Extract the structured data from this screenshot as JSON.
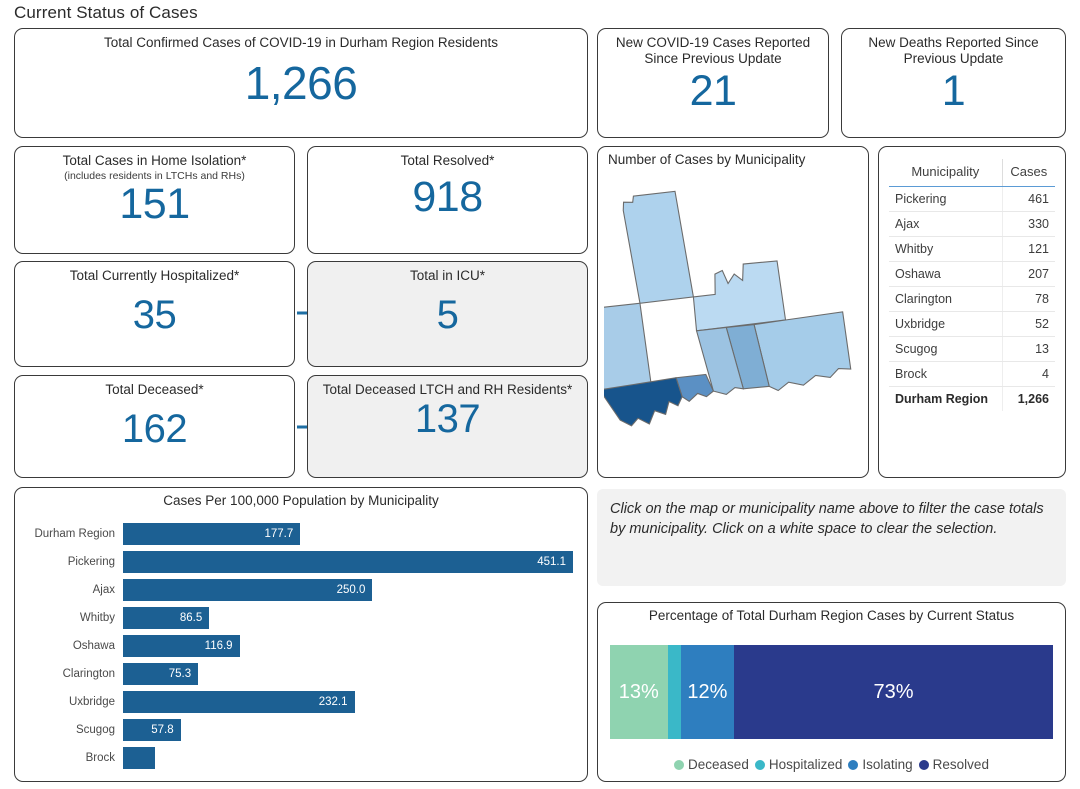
{
  "page_title": "Current Status of Cases",
  "colors": {
    "kpi_blue": "#15679E",
    "bar_blue": "#1C6093",
    "arrow_blue": "#1D6EA3",
    "deceased": "#8FD3B0",
    "hospitalized": "#3AB8C8",
    "isolating": "#2E7EBF",
    "resolved": "#2A3A8C",
    "card_border": "#3A3A3A",
    "shaded_card_bg": "#F0F0F0"
  },
  "cards": {
    "total_confirmed": {
      "title": "Total Confirmed Cases of COVID-19 in Durham Region Residents",
      "value": "1,266"
    },
    "new_cases": {
      "title": "New COVID-19 Cases Reported Since Previous Update",
      "value": "21"
    },
    "new_deaths": {
      "title": "New Deaths Reported Since Previous Update",
      "value": "1"
    },
    "home_isolation": {
      "title": "Total Cases in Home Isolation*",
      "subtitle": "(includes residents in LTCHs and RHs)",
      "value": "151"
    },
    "resolved": {
      "title": "Total Resolved*",
      "value": "918"
    },
    "hospitalized": {
      "title": "Total Currently Hospitalized*",
      "value": "35"
    },
    "icu": {
      "title": "Total in ICU*",
      "value": "5"
    },
    "deceased": {
      "title": "Total Deceased*",
      "value": "162"
    },
    "deceased_ltch": {
      "title": "Total Deceased LTCH and RH Residents*",
      "value": "137"
    }
  },
  "map_panel": {
    "title": "Number of Cases by Municipality"
  },
  "municipality_table": {
    "headers": [
      "Municipality",
      "Cases"
    ],
    "rows": [
      {
        "name": "Pickering",
        "cases": "461"
      },
      {
        "name": "Ajax",
        "cases": "330"
      },
      {
        "name": "Whitby",
        "cases": "121"
      },
      {
        "name": "Oshawa",
        "cases": "207"
      },
      {
        "name": "Clarington",
        "cases": "78"
      },
      {
        "name": "Uxbridge",
        "cases": "52"
      },
      {
        "name": "Scugog",
        "cases": "13"
      },
      {
        "name": "Brock",
        "cases": "4"
      }
    ],
    "total": {
      "name": "Durham Region",
      "cases": "1,266"
    }
  },
  "instructions": {
    "text": "Click on the map or municipality name above to filter the case totals by municipality. Click on a white space to clear the selection."
  },
  "chart_data": [
    {
      "type": "bar",
      "title": "Cases Per 100,000 Population by Municipality",
      "orientation": "horizontal",
      "xlabel": "",
      "ylabel": "",
      "categories": [
        "Durham Region",
        "Pickering",
        "Ajax",
        "Whitby",
        "Oshawa",
        "Clarington",
        "Uxbridge",
        "Scugog",
        "Brock"
      ],
      "values": [
        177.7,
        451.1,
        250.0,
        86.5,
        116.9,
        75.3,
        232.1,
        57.8,
        21.5
      ],
      "labels": [
        "177.7",
        "451.1",
        "250.0",
        "86.5",
        "116.9",
        "75.3",
        "232.1",
        "57.8",
        ""
      ],
      "xlim": [
        0,
        451.1
      ],
      "grid": false,
      "legend": "none",
      "series_color": "#1C6093"
    },
    {
      "type": "bar",
      "subtype": "stacked-100-percent",
      "title": "Percentage of Total Durham Region Cases by Current Status",
      "categories": [
        "Durham Region"
      ],
      "series": [
        {
          "name": "Deceased",
          "values": [
            13
          ],
          "label": "13%",
          "color": "#8FD3B0"
        },
        {
          "name": "Hospitalized",
          "values": [
            3
          ],
          "label": "",
          "color": "#3AB8C8"
        },
        {
          "name": "Isolating",
          "values": [
            12
          ],
          "label": "12%",
          "color": "#2E7EBF"
        },
        {
          "name": "Resolved",
          "values": [
            72
          ],
          "label": "73%",
          "color": "#2A3A8C"
        }
      ],
      "legend": "bottom",
      "grid": false
    }
  ],
  "map_data": {
    "type": "choropleth",
    "regions": [
      {
        "name": "Brock",
        "shade": "#AED2ED"
      },
      {
        "name": "Uxbridge",
        "shade": "#A8CCE8"
      },
      {
        "name": "Scugog",
        "shade": "#BBDAF2"
      },
      {
        "name": "Clarington",
        "shade": "#A5CCE9"
      },
      {
        "name": "Pickering",
        "shade": "#17548C"
      },
      {
        "name": "Ajax",
        "shade": "#5B90C4"
      },
      {
        "name": "Whitby",
        "shade": "#9CC3E2"
      },
      {
        "name": "Oshawa",
        "shade": "#7FAED4"
      }
    ]
  }
}
